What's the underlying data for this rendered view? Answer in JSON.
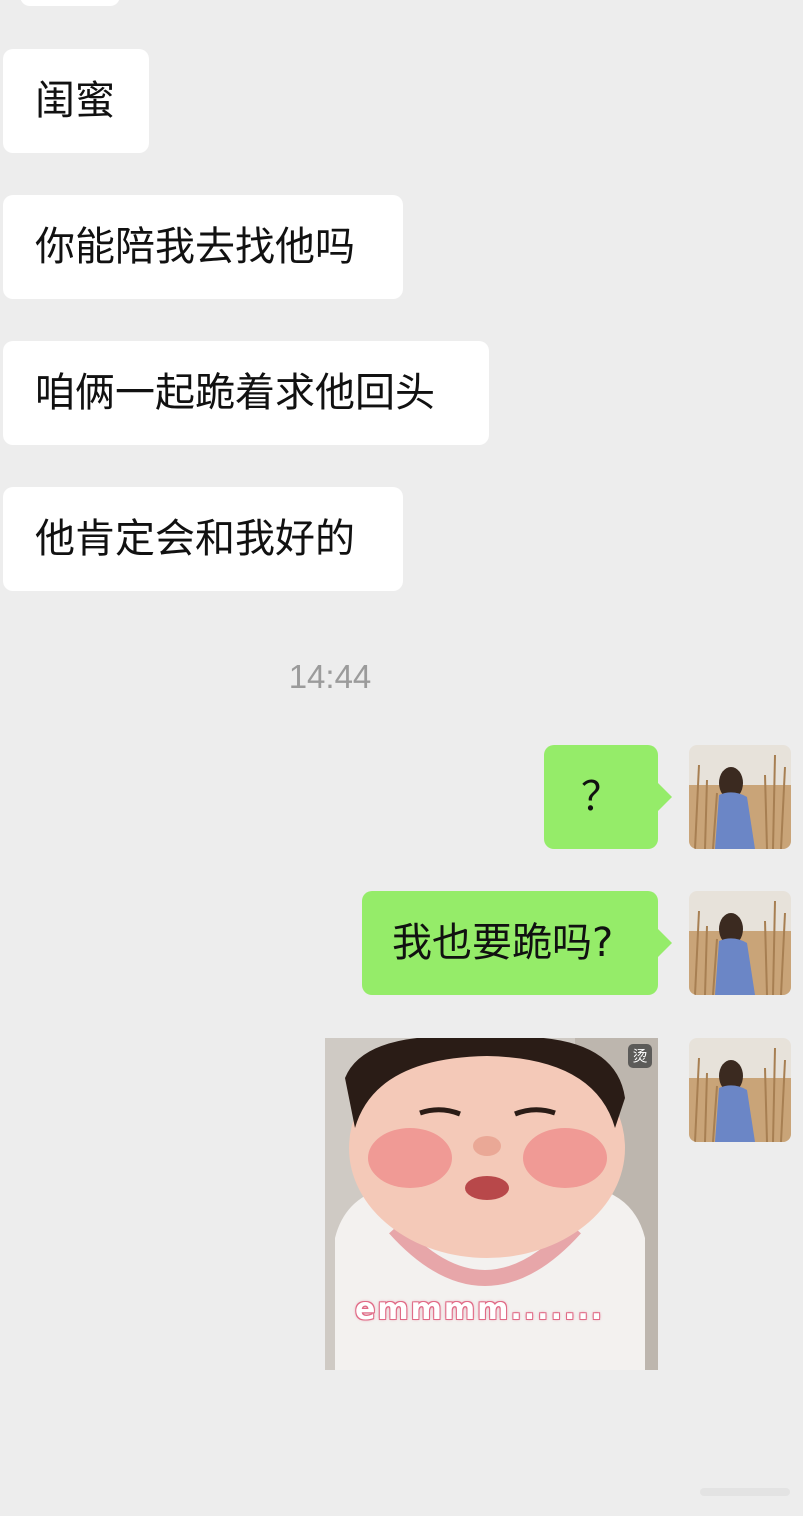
{
  "incoming_messages": [
    {
      "text": "闺蜜"
    },
    {
      "text": "你能陪我去找他吗"
    },
    {
      "text": "咱俩一起跪着求他回头"
    },
    {
      "text": "他肯定会和我好的"
    }
  ],
  "timestamp": "14:44",
  "outgoing_messages": [
    {
      "text": "？"
    },
    {
      "text": "我也要跪吗?"
    }
  ],
  "sticker": {
    "caption": "emmmm.......",
    "badge": "烫",
    "icon": "crying-child-sticker"
  },
  "avatar": {
    "icon": "woman-in-reeds-avatar"
  },
  "colors": {
    "background": "#ededed",
    "incoming_bubble": "#ffffff",
    "outgoing_bubble": "#95ec69",
    "timestamp_text": "#9b9b9b"
  }
}
